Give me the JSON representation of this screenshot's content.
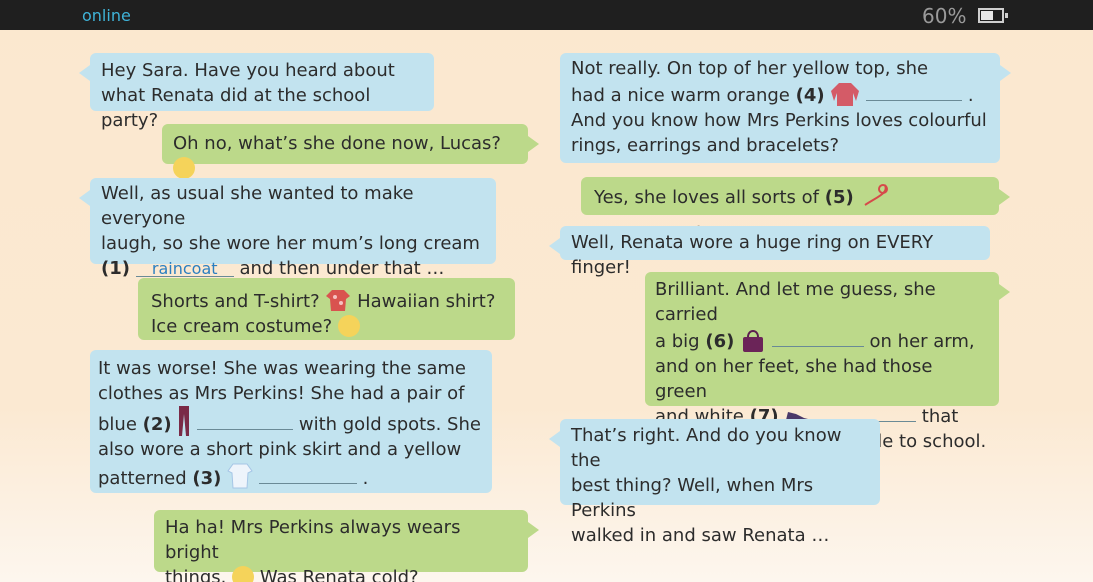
{
  "status": {
    "label": "online",
    "battery_pct": "60%"
  },
  "bubbles": {
    "b1": [
      "Hey Sara. Have you heard about",
      "what Renata did at the school party?"
    ],
    "b2": "Oh no, what’s she done now, Lucas?",
    "b3": [
      "Well, as usual she wanted to make everyone",
      "laugh, so she wore her mum’s long cream",
      "(1)",
      "raincoat",
      "and then under that …"
    ],
    "b4": [
      "Shorts and T-shirt?",
      "Hawaiian shirt?",
      "Ice cream costume?"
    ],
    "b5": [
      "It was worse! She was wearing the same",
      "clothes as Mrs Perkins! She had a pair of",
      "blue",
      "(2)",
      "with gold spots. She",
      "also wore a short pink skirt and a yellow",
      "patterned",
      "(3)",
      "."
    ],
    "b6": [
      "Ha ha! Mrs Perkins always wears bright",
      "things.",
      "Was Renata cold?"
    ],
    "b7": [
      "Not really. On top of her yellow top, she",
      "had a nice warm orange",
      "(4)",
      ".",
      "And you know how Mrs Perkins loves colourful",
      "rings, earrings and bracelets?"
    ],
    "b8": [
      "Yes, she loves all sorts of",
      "(5)",
      "."
    ],
    "b9": "Well, Renata wore a huge ring on EVERY finger!",
    "b10": [
      "Brilliant. And let me guess, she carried",
      "a big",
      "(6)",
      "on her arm,",
      "and on her feet, she had those green",
      "and white",
      "(7)",
      "that",
      "Mrs Perkins wears to cycle to school."
    ],
    "b11": [
      "That’s right. And do you know the",
      "best thing? Well, when Mrs Perkins",
      "walked in and saw Renata …"
    ]
  },
  "icons": [
    "thinking-emoji",
    "shirt-icon",
    "smile-emoji",
    "trousers-icon",
    "top-icon",
    "jumper-icon",
    "necklace-icon",
    "handbag-icon",
    "trainers-icon",
    "laughing-emoji"
  ]
}
